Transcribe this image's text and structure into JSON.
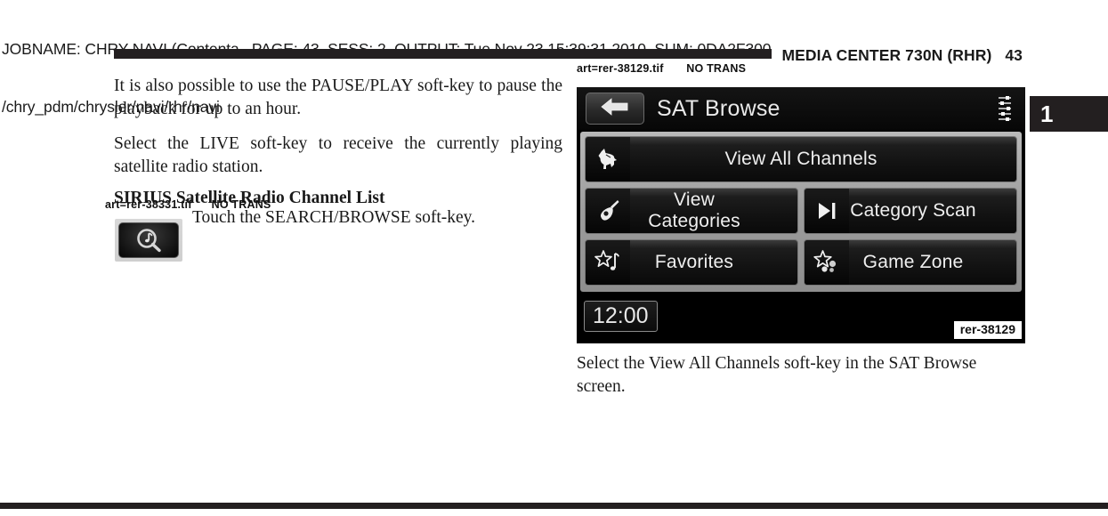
{
  "job_header": {
    "line1": "JOBNAME: CHRY NAVI (Contenta   PAGE: 43  SESS: 2  OUTPUT: Tue Nov 23 15:39:31 2010  SUM: 0DA2F300",
    "line2": "/chry_pdm/chrysler/navi/rhr/navi"
  },
  "running_head": {
    "title": "MEDIA CENTER 730N (RHR)   43",
    "section_tab": "1"
  },
  "left_column": {
    "paragraph_1": "It is also possible to use the PAUSE/PLAY soft-key to pause the playback for up to an hour.",
    "paragraph_2": "Select the LIVE soft-key to receive the currently playing satellite radio station.",
    "subhead": "SIRIUS Satellite Radio Channel List",
    "art_tag": "art=rer-38331.tif      NO TRANS",
    "instruction": "Touch the SEARCH/BROWSE soft-key.",
    "search_icon_name": "search-browse-magnifier-note-icon"
  },
  "right_column": {
    "art_tag": "art=rer-38129.tif       NO TRANS",
    "art_caption": "rer-38129",
    "caption_text": "Select the View All Channels soft-key in the SAT Browse screen.",
    "screen": {
      "title": "SAT Browse",
      "back_icon": "back-arrow-icon",
      "equalizer_icon": "equalizer-sliders-icon",
      "clock": "12:00",
      "softkeys": [
        {
          "label": "View All Channels",
          "icon": "sirius-dog-icon",
          "full_width": true
        },
        {
          "label": "View Categories",
          "icon": "guitar-icon",
          "full_width": false
        },
        {
          "label": "Category Scan",
          "icon": "scan-next-icon",
          "full_width": false
        },
        {
          "label": "Favorites",
          "icon": "star-note-icon",
          "full_width": false
        },
        {
          "label": "Game Zone",
          "icon": "star-balls-icon",
          "full_width": false
        }
      ]
    }
  },
  "colors": {
    "rule": "#231f20",
    "screen_bg": "#000000",
    "panel_bg": "#9c9c9c",
    "softkey_text": "#efefef"
  }
}
